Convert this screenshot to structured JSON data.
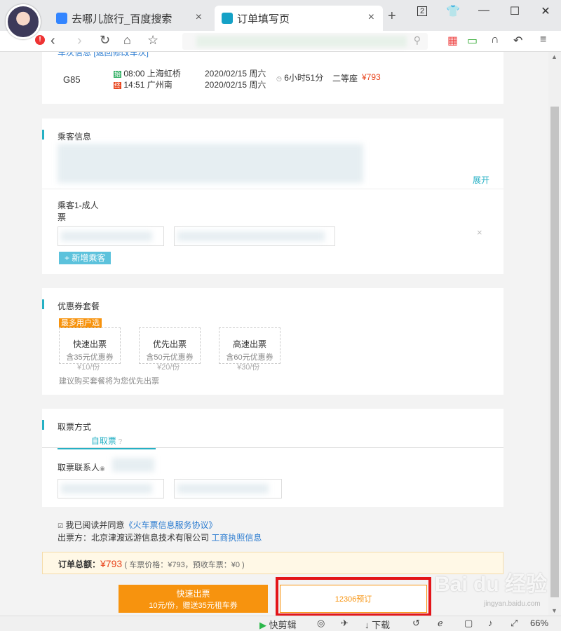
{
  "browser": {
    "tabs": [
      {
        "label": "去哪儿旅行_百度搜索"
      },
      {
        "label": "订单填写页"
      }
    ],
    "new_tab": "+",
    "window_count": "2",
    "status": {
      "quick_edit": "快剪辑",
      "download": "下载",
      "zoom": "66%"
    }
  },
  "train": {
    "number": "G85",
    "header_partial": "车次信息 [返回修改车次]",
    "depart_tag": "始",
    "arrive_tag": "终",
    "depart_time": "08:00",
    "depart_station": "上海虹桥",
    "arrive_time": "14:51",
    "arrive_station": "广州南",
    "depart_date": "2020/02/15 周六",
    "arrive_date": "2020/02/15 周六",
    "duration": "6小时51分",
    "seat": "二等座",
    "price": "¥793"
  },
  "passenger_section": {
    "title": "乘客信息",
    "expand": "展开",
    "passenger_label": "乘客1-成人",
    "ticket_label": "票",
    "remove": "×",
    "add_button": "+ 新增乘客"
  },
  "coupon_section": {
    "title": "优惠券套餐",
    "tag": "最多用户选",
    "packages": [
      {
        "name": "快速出票",
        "desc": "含35元优惠券",
        "price": "¥10/份"
      },
      {
        "name": "优先出票",
        "desc": "含50元优惠券",
        "price": "¥20/份"
      },
      {
        "name": "高速出票",
        "desc": "含60元优惠券",
        "price": "¥30/份"
      }
    ],
    "note": "建议购买套餐将为您优先出票"
  },
  "pickup_section": {
    "title": "取票方式",
    "tab": "自取票",
    "contact_label": "取票联系人"
  },
  "agreement": {
    "text": "我已阅读并同意",
    "link": "《火车票信息服务协议》",
    "issuer_prefix": "出票方：北京津渡远游信息技术有限公司",
    "license_link": "工商执照信息"
  },
  "summary": {
    "label": "订单总额：",
    "total": "¥793",
    "detail": "( 车票价格：¥793，预收车票：¥0 )"
  },
  "actions": {
    "fast_line1": "快速出票",
    "fast_line2": "10元/份，赠送35元租车券",
    "book": "12306预订"
  },
  "watermark": {
    "text": "Bai du 经验",
    "url": "jingyan.baidu.com"
  },
  "colors": {
    "accent": "#25b0c4",
    "price": "#e8451d",
    "orange": "#f7930e",
    "highlight": "#e3151a"
  }
}
